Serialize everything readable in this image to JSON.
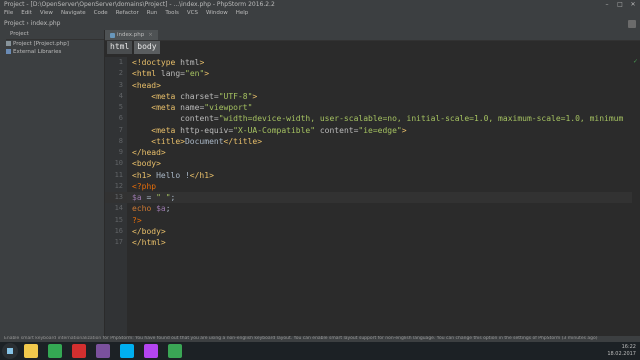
{
  "window": {
    "title": "Project - [D:\\OpenServer\\OpenServer\\domains\\Project] - ...\\index.php - PhpStorm 2016.2.2",
    "controls": [
      "–",
      "□",
      "✕"
    ]
  },
  "menu": [
    "File",
    "Edit",
    "View",
    "Navigate",
    "Code",
    "Refactor",
    "Run",
    "Tools",
    "VCS",
    "Window",
    "Help"
  ],
  "navbar": {
    "crumbs": "Project  ›  index.php"
  },
  "project_panel": {
    "header": "Project",
    "items": [
      {
        "label": "Project [Project.php]",
        "icon": "folder-icon"
      },
      {
        "label": "External Libraries",
        "icon": "library-icon"
      }
    ]
  },
  "editor": {
    "tab": {
      "label": "index.php",
      "close": "×"
    },
    "breadcrumbs": [
      "html",
      "body"
    ],
    "lines": [
      {
        "n": "1",
        "segments": [
          [
            "tag",
            "<!doctype "
          ],
          [
            "attr",
            "html"
          ],
          [
            "tag",
            ">"
          ]
        ]
      },
      {
        "n": "2",
        "segments": [
          [
            "tag",
            "<html "
          ],
          [
            "attr",
            "lang="
          ],
          [
            "str",
            "\"en\""
          ],
          [
            "tag",
            ">"
          ]
        ]
      },
      {
        "n": "3",
        "segments": [
          [
            "tag",
            "<head>"
          ]
        ]
      },
      {
        "n": "4",
        "segments": [
          [
            "plain",
            "    "
          ],
          [
            "tag",
            "<meta "
          ],
          [
            "attr",
            "charset="
          ],
          [
            "str",
            "\"UTF-8\""
          ],
          [
            "tag",
            ">"
          ]
        ]
      },
      {
        "n": "5",
        "segments": [
          [
            "plain",
            "    "
          ],
          [
            "tag",
            "<meta "
          ],
          [
            "attr",
            "name="
          ],
          [
            "str",
            "\"viewport\""
          ]
        ]
      },
      {
        "n": "6",
        "segments": [
          [
            "plain",
            "          "
          ],
          [
            "attr",
            "content="
          ],
          [
            "str",
            "\"width=device-width, user-scalable=no, initial-scale=1.0, maximum-scale=1.0, minimum"
          ]
        ]
      },
      {
        "n": "7",
        "segments": [
          [
            "plain",
            "    "
          ],
          [
            "tag",
            "<meta "
          ],
          [
            "attr",
            "http-equiv="
          ],
          [
            "str",
            "\"X-UA-Compatible\" "
          ],
          [
            "attr",
            "content="
          ],
          [
            "str",
            "\"ie=edge\""
          ],
          [
            "tag",
            ">"
          ]
        ]
      },
      {
        "n": "8",
        "segments": [
          [
            "plain",
            "    "
          ],
          [
            "tag",
            "<title>"
          ],
          [
            "plain",
            "Document"
          ],
          [
            "tag",
            "</title>"
          ]
        ]
      },
      {
        "n": "9",
        "segments": [
          [
            "tag",
            "</head>"
          ]
        ]
      },
      {
        "n": "10",
        "segments": [
          [
            "tag",
            "<body>"
          ]
        ]
      },
      {
        "n": "11",
        "segments": [
          [
            "tag",
            "<h1>"
          ],
          [
            "plain",
            " Hello !"
          ],
          [
            "tag",
            "</h1>"
          ]
        ]
      },
      {
        "n": "12",
        "segments": [
          [
            "php",
            "<?php"
          ]
        ]
      },
      {
        "n": "13",
        "segments": [
          [
            "var",
            "$a"
          ],
          [
            "plain",
            " = "
          ],
          [
            "str",
            "\" \""
          ],
          [
            "plain",
            ";"
          ]
        ]
      },
      {
        "n": "14",
        "segments": [
          [
            "kw",
            "echo "
          ],
          [
            "var",
            "$a"
          ],
          [
            "plain",
            ";"
          ]
        ]
      },
      {
        "n": "15",
        "segments": [
          [
            "php",
            "?>"
          ]
        ]
      },
      {
        "n": "16",
        "segments": [
          [
            "tag",
            "</body>"
          ]
        ]
      },
      {
        "n": "17",
        "segments": [
          [
            "tag",
            "</html>"
          ]
        ]
      }
    ]
  },
  "status": {
    "message": "Enable smart keyboard internationalization for PhpStorm: You have found out that you are using a non-english keyboard layout. You can enable smart layout support for non-english language. You can change this option in the settings of PhpStorm (3 minutes ago)"
  },
  "taskbar": {
    "time": "16:22",
    "date": "18.02.2017",
    "apps": [
      {
        "name": "explorer-icon",
        "color": "#f2c94c"
      },
      {
        "name": "chrome-icon",
        "color": "#34a853"
      },
      {
        "name": "opera-icon",
        "color": "#d32f2f"
      },
      {
        "name": "viber-icon",
        "color": "#7b519d"
      },
      {
        "name": "skype-icon",
        "color": "#00aff0"
      },
      {
        "name": "phpstorm-icon",
        "color": "#b345f1"
      },
      {
        "name": "camtasia-icon",
        "color": "#3aa655"
      }
    ]
  }
}
